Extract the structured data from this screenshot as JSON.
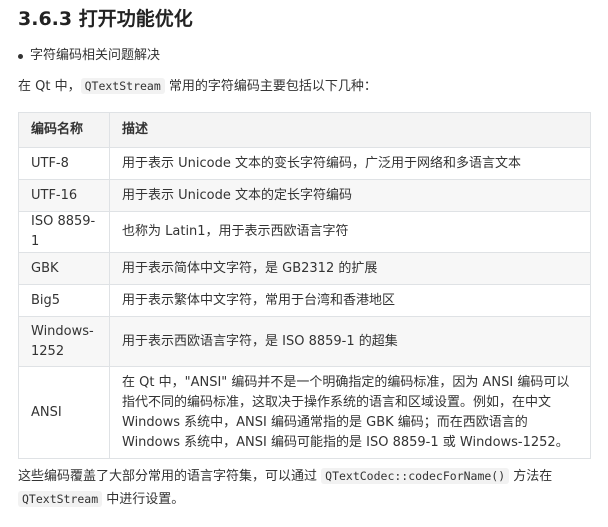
{
  "section": {
    "title": "3.6.3 打开功能优化",
    "bullet": "字符编码相关问题解决"
  },
  "intro": {
    "prefix": "在 Qt 中，",
    "code": "QTextStream",
    "suffix": " 常用的字符编码主要包括以下几种："
  },
  "table": {
    "headers": [
      "编码名称",
      "描述"
    ],
    "rows": [
      [
        "UTF-8",
        "用于表示 Unicode 文本的变长字符编码，广泛用于网络和多语言文本"
      ],
      [
        "UTF-16",
        "用于表示 Unicode 文本的定长字符编码"
      ],
      [
        "ISO 8859-1",
        "也称为 Latin1，用于表示西欧语言字符"
      ],
      [
        "GBK",
        "用于表示简体中文字符，是 GB2312 的扩展"
      ],
      [
        "Big5",
        "用于表示繁体中文字符，常用于台湾和香港地区"
      ],
      [
        "Windows-1252",
        "用于表示西欧语言字符，是 ISO 8859-1 的超集"
      ],
      [
        "ANSI",
        "在 Qt 中，\"ANSI\" 编码并不是一个明确指定的编码标准，因为 ANSI 编码可以指代不同的编码标准，这取决于操作系统的语言和区域设置。例如，在中文 Windows 系统中，ANSI 编码通常指的是 GBK 编码；而在西欧语言的 Windows 系统中，ANSI 编码可能指的是 ISO 8859-1 或 Windows-1252。"
      ]
    ]
  },
  "outro": {
    "line1_prefix": "这些编码覆盖了大部分常用的语言字符集，可以通过 ",
    "line1_code": "QTextCodec::codecForName()",
    "line1_suffix": " 方法在",
    "line2_code": "QTextStream",
    "line2_suffix": " 中进行设置。"
  }
}
